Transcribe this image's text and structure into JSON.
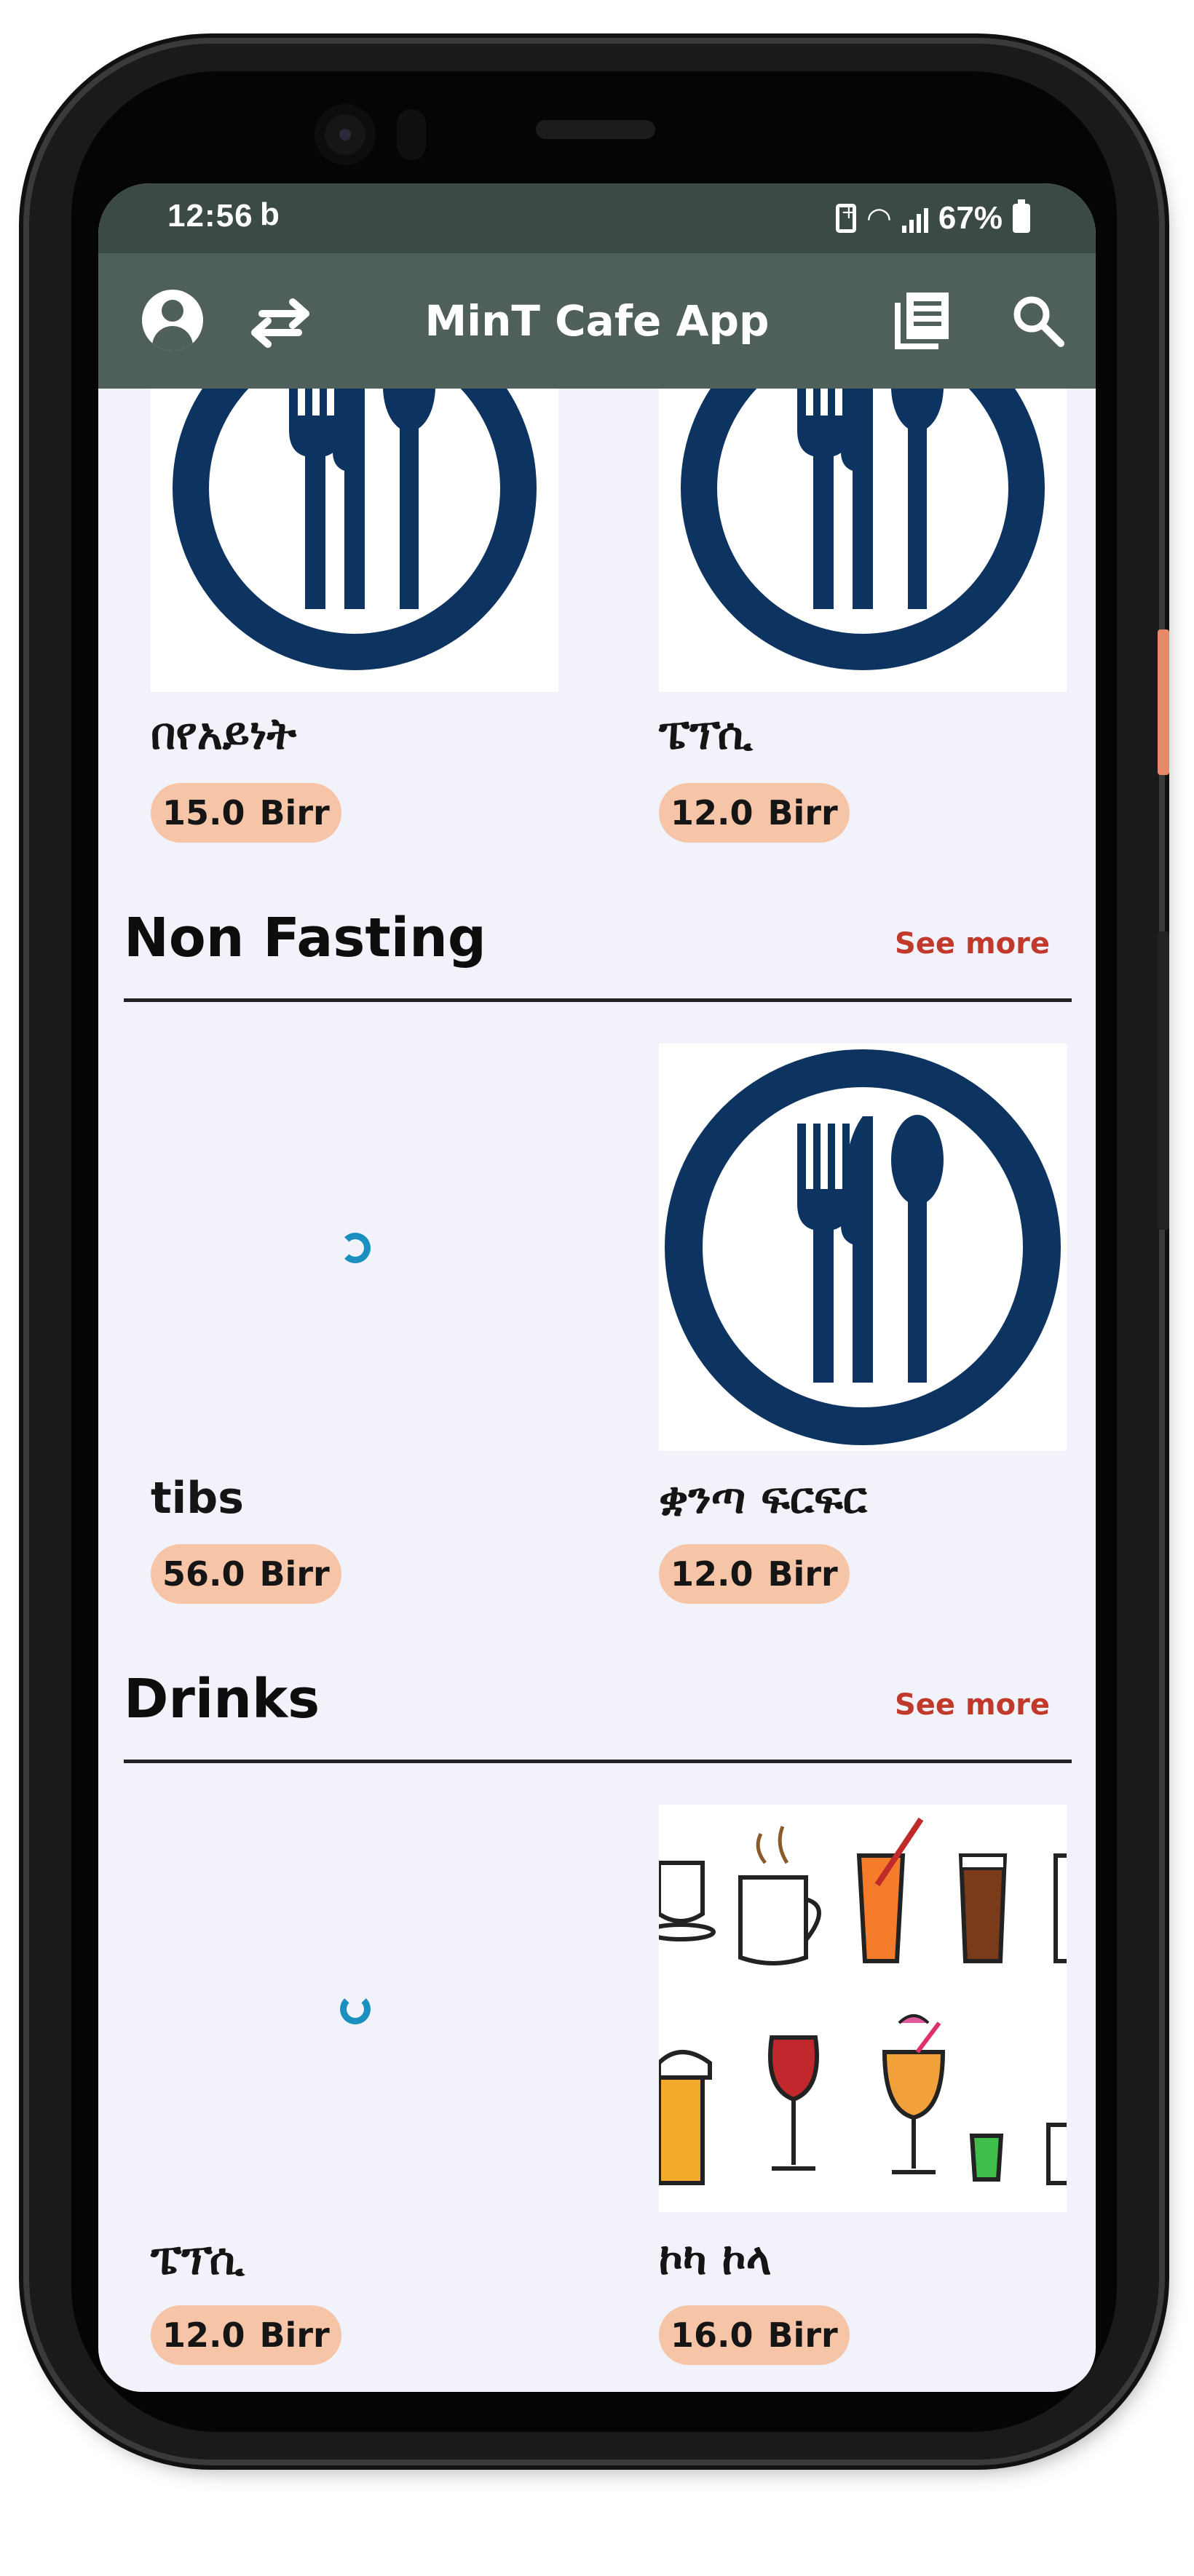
{
  "status_bar": {
    "time": "12:56",
    "b_icon": "b",
    "battery": "67%"
  },
  "app_bar": {
    "title": "MinT Cafe App"
  },
  "top_items": [
    {
      "name": "በየአይነት",
      "price": "15.0",
      "currency": "Birr",
      "image": "plate-utensils-icon"
    },
    {
      "name": "ፔፕሲ",
      "price": "12.0",
      "currency": "Birr",
      "image": "plate-utensils-icon"
    }
  ],
  "sections": [
    {
      "title": "Non Fasting",
      "see_more": "See more",
      "items": [
        {
          "name": "tibs",
          "price": "56.0",
          "currency": "Birr",
          "image": "loading-spinner"
        },
        {
          "name": "ቋንጣ ፍርፍር",
          "price": "12.0",
          "currency": "Birr",
          "image": "plate-utensils-icon"
        }
      ]
    },
    {
      "title": "Drinks",
      "see_more": "See more",
      "items": [
        {
          "name": "ፔፕሲ",
          "price": "12.0",
          "currency": "Birr",
          "image": "loading-spinner"
        },
        {
          "name": "ኮካ ኮላ",
          "price": "16.0",
          "currency": "Birr",
          "image": "drinks-illustration"
        }
      ]
    }
  ],
  "colors": {
    "status_bar": "#3c4a45",
    "app_bar": "#4f5f5a",
    "screen_bg": "#f2f3fa",
    "price_pill": "#f6c4a6",
    "see_more": "#c0392b",
    "plate_navy": "#0d3461",
    "spinner": "#1b8fbf"
  }
}
